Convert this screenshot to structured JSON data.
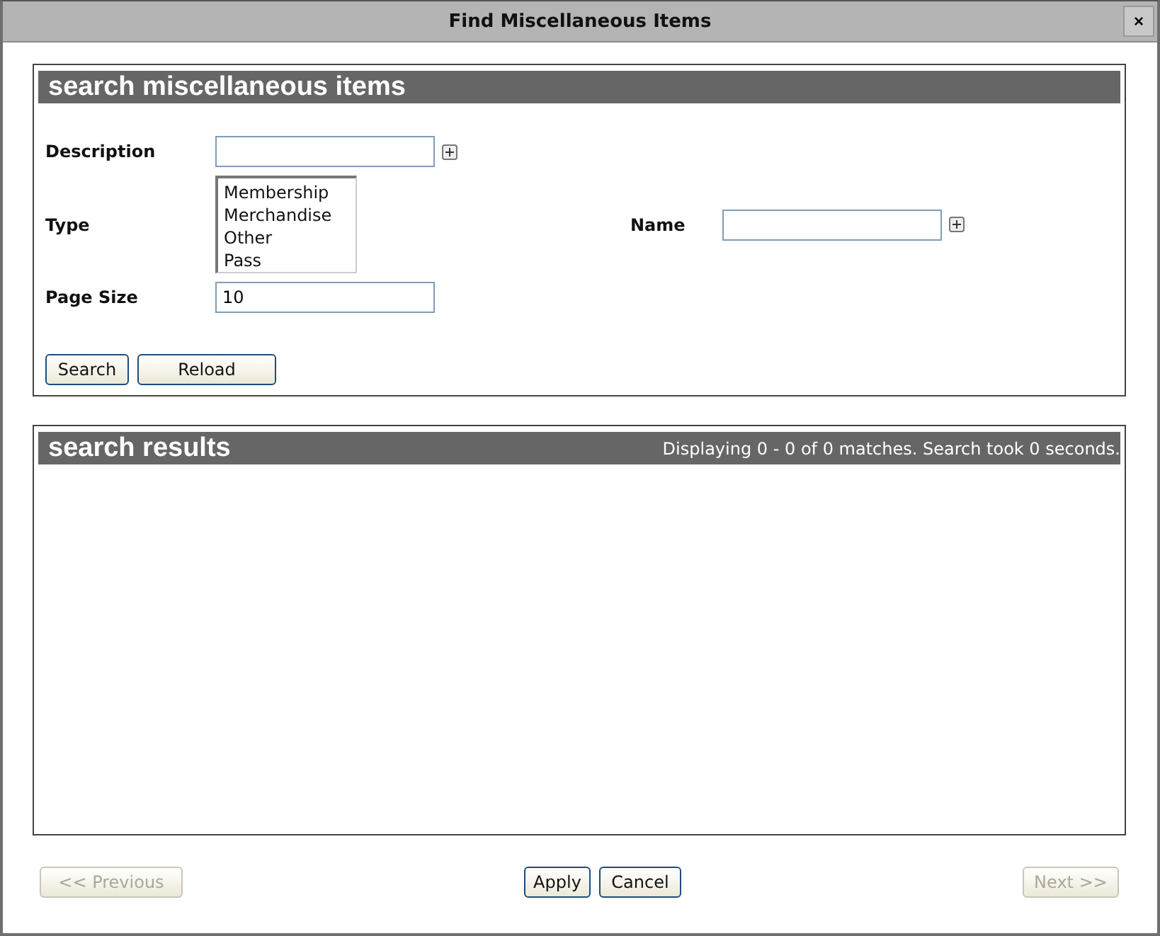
{
  "window": {
    "title": "Find Miscellaneous Items",
    "close": "×"
  },
  "search_panel": {
    "heading": "search miscellaneous items",
    "description": {
      "label": "Description"
    },
    "type": {
      "label": "Type",
      "options": [
        {
          "label": "Membership",
          "selected": false
        },
        {
          "label": "Merchandise",
          "selected": false
        },
        {
          "label": "Other",
          "selected": false
        },
        {
          "label": "Pass",
          "selected": false
        }
      ]
    },
    "name": {
      "label": "Name"
    },
    "page_size": {
      "label": "Page Size",
      "value": "10"
    },
    "buttons": [
      "Search",
      "Reload"
    ]
  },
  "results_panel": {
    "heading": "search results",
    "status": "Displaying 0 - 0 of 0 matches. Search took 0 seconds."
  },
  "footer": {
    "previous": {
      "label": "<< Previous",
      "disabled": true
    },
    "buttons": [
      "Apply",
      "Cancel"
    ],
    "next": {
      "label": "Next >>",
      "disabled": true
    }
  }
}
